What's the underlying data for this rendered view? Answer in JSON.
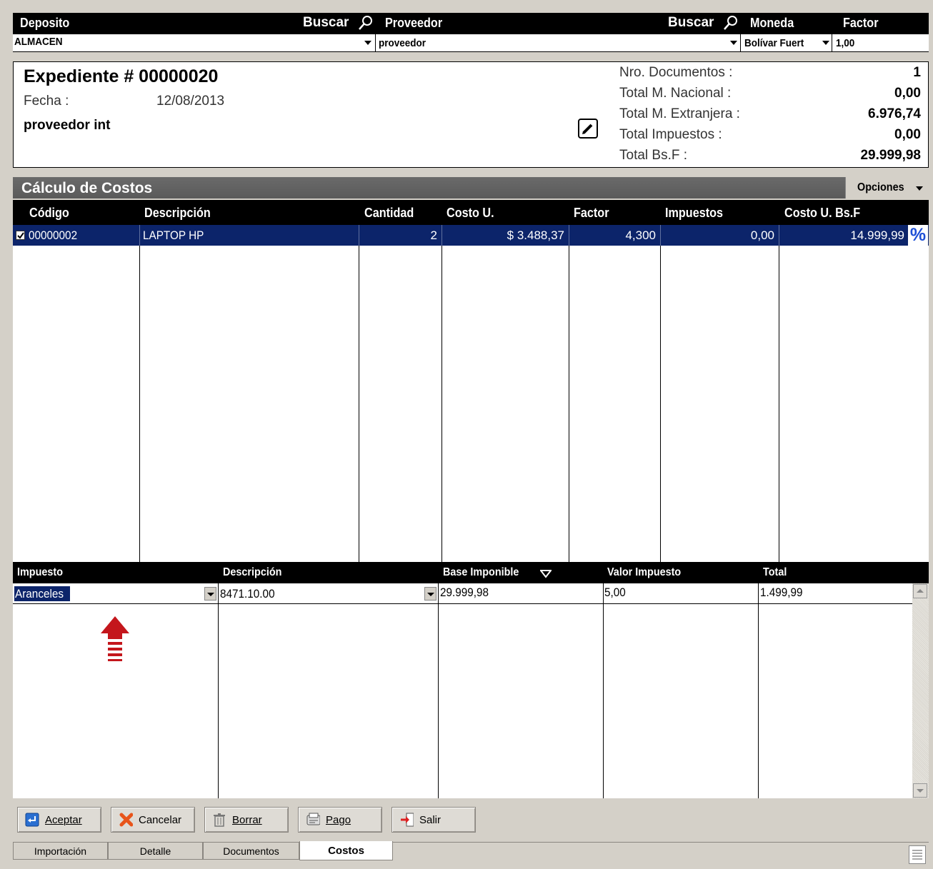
{
  "top": {
    "deposito_label": "Deposito",
    "buscar_label": "Buscar",
    "proveedor_label": "Proveedor",
    "buscar2_label": "Buscar",
    "moneda_label": "Moneda",
    "factor_label": "Factor",
    "deposito_value": "ALMACEN",
    "proveedor_value": "proveedor",
    "moneda_value": "Bolívar Fuert",
    "factor_value": "1,00"
  },
  "info": {
    "expediente": "Expediente # 00000020",
    "fecha_label": "Fecha :",
    "fecha_value": "12/08/2013",
    "proveedor_name": "proveedor int",
    "summary": [
      {
        "label": "Nro. Documentos :",
        "value": "1"
      },
      {
        "label": "Total M. Nacional :",
        "value": "0,00"
      },
      {
        "label": "Total M. Extranjera :",
        "value": "6.976,74"
      },
      {
        "label": "Total Impuestos :",
        "value": "0,00"
      },
      {
        "label": "Total Bs.F :",
        "value": "29.999,98"
      }
    ]
  },
  "costos": {
    "title": "Cálculo de Costos",
    "opciones": "Opciones",
    "columns": [
      "Código",
      "Descripción",
      "Cantidad",
      "Costo U.",
      "Factor",
      "Impuestos",
      "Costo U. Bs.F"
    ],
    "row": {
      "codigo": "00000002",
      "descripcion": "LAPTOP HP",
      "cantidad": "2",
      "costo_u": "$ 3.488,37",
      "factor": "4,300",
      "impuestos": "0,00",
      "costo_bsf": "14.999,99",
      "percent": "%"
    }
  },
  "tax": {
    "columns": [
      "Impuesto",
      "Descripción",
      "Base Imponible",
      "Valor Impuesto",
      "Total"
    ],
    "row": {
      "impuesto": "Aranceles",
      "descripcion": "8471.10.00",
      "base": "29.999,98",
      "valor": "5,00",
      "total": "1.499,99"
    }
  },
  "buttons": {
    "aceptar": "Aceptar",
    "cancelar": "Cancelar",
    "borrar": "Borrar",
    "pago": "Pago",
    "salir": "Salir"
  },
  "tabs": [
    "Importación",
    "Detalle",
    "Documentos",
    "Costos"
  ]
}
